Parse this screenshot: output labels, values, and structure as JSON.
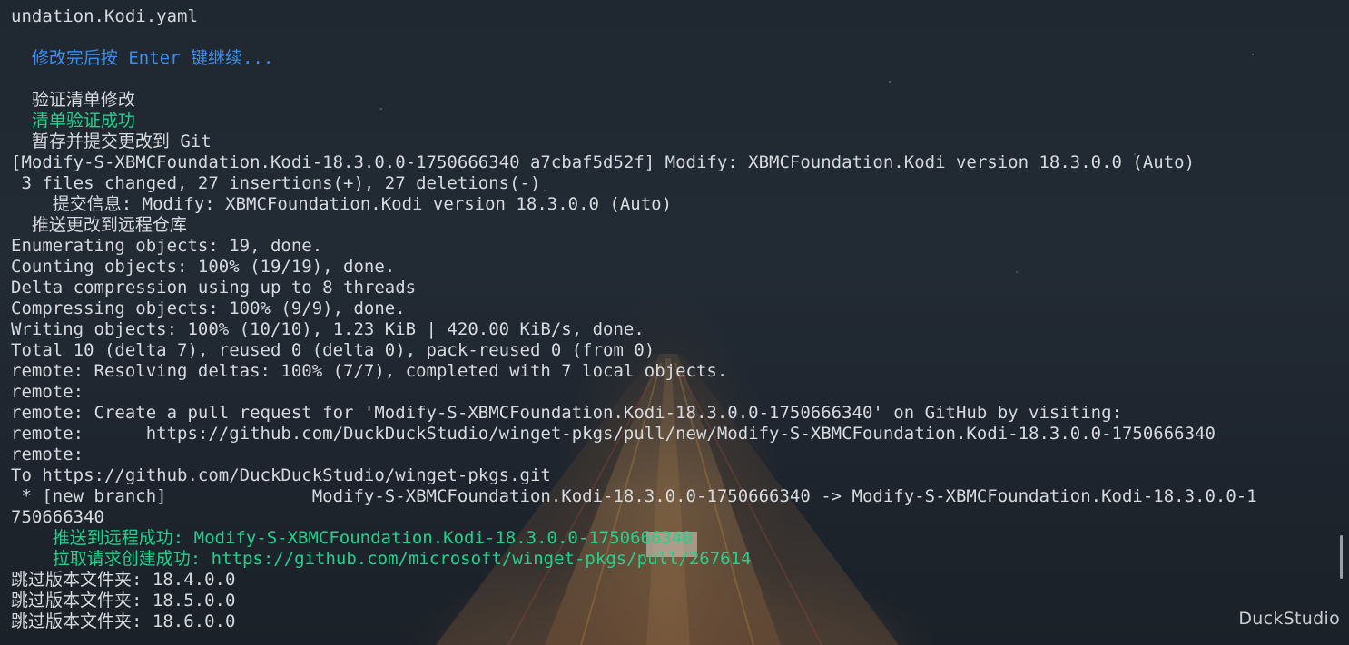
{
  "terminal": {
    "lines": [
      {
        "text": "undation.Kodi.yaml",
        "color": "default"
      },
      {
        "text": "",
        "color": "default"
      },
      {
        "text": "  修改完后按 Enter 键继续...",
        "color": "blue"
      },
      {
        "text": "",
        "color": "default"
      },
      {
        "text": "  验证清单修改",
        "color": "default"
      },
      {
        "text": "  清单验证成功",
        "color": "green"
      },
      {
        "text": "  暂存并提交更改到 Git",
        "color": "default"
      },
      {
        "text": "[Modify-S-XBMCFoundation.Kodi-18.3.0.0-1750666340 a7cbaf5d52f] Modify: XBMCFoundation.Kodi version 18.3.0.0 (Auto)",
        "color": "default"
      },
      {
        "text": " 3 files changed, 27 insertions(+), 27 deletions(-)",
        "color": "default"
      },
      {
        "text": "    提交信息: Modify: XBMCFoundation.Kodi version 18.3.0.0 (Auto)",
        "color": "default"
      },
      {
        "text": "  推送更改到远程仓库",
        "color": "default"
      },
      {
        "text": "Enumerating objects: 19, done.",
        "color": "default"
      },
      {
        "text": "Counting objects: 100% (19/19), done.",
        "color": "default"
      },
      {
        "text": "Delta compression using up to 8 threads",
        "color": "default"
      },
      {
        "text": "Compressing objects: 100% (9/9), done.",
        "color": "default"
      },
      {
        "text": "Writing objects: 100% (10/10), 1.23 KiB | 420.00 KiB/s, done.",
        "color": "default"
      },
      {
        "text": "Total 10 (delta 7), reused 0 (delta 0), pack-reused 0 (from 0)",
        "color": "default"
      },
      {
        "text": "remote: Resolving deltas: 100% (7/7), completed with 7 local objects.",
        "color": "default"
      },
      {
        "text": "remote:",
        "color": "default"
      },
      {
        "text": "remote: Create a pull request for 'Modify-S-XBMCFoundation.Kodi-18.3.0.0-1750666340' on GitHub by visiting:",
        "color": "default"
      },
      {
        "text": "remote:      https://github.com/DuckDuckStudio/winget-pkgs/pull/new/Modify-S-XBMCFoundation.Kodi-18.3.0.0-1750666340",
        "color": "default"
      },
      {
        "text": "remote:",
        "color": "default"
      },
      {
        "text": "To https://github.com/DuckDuckStudio/winget-pkgs.git",
        "color": "default"
      },
      {
        "text": " * [new branch]              Modify-S-XBMCFoundation.Kodi-18.3.0.0-1750666340 -> Modify-S-XBMCFoundation.Kodi-18.3.0.0-1",
        "color": "default"
      },
      {
        "text": "750666340",
        "color": "default"
      },
      {
        "text": "    推送到远程成功: Modify-S-XBMCFoundation.Kodi-18.3.0.0-1750666340",
        "color": "green"
      },
      {
        "text": "    拉取请求创建成功: https://github.com/microsoft/winget-pkgs/pull/267614",
        "color": "green"
      },
      {
        "text": "跳过版本文件夹: 18.4.0.0",
        "color": "default"
      },
      {
        "text": "跳过版本文件夹: 18.5.0.0",
        "color": "default"
      },
      {
        "text": "跳过版本文件夹: 18.6.0.0",
        "color": "default"
      }
    ]
  },
  "watermark": "DuckStudio",
  "colors": {
    "default_text": "#d6d9de",
    "blue": "#3b8eea",
    "green": "#23d18b",
    "background": "#1f2731"
  }
}
